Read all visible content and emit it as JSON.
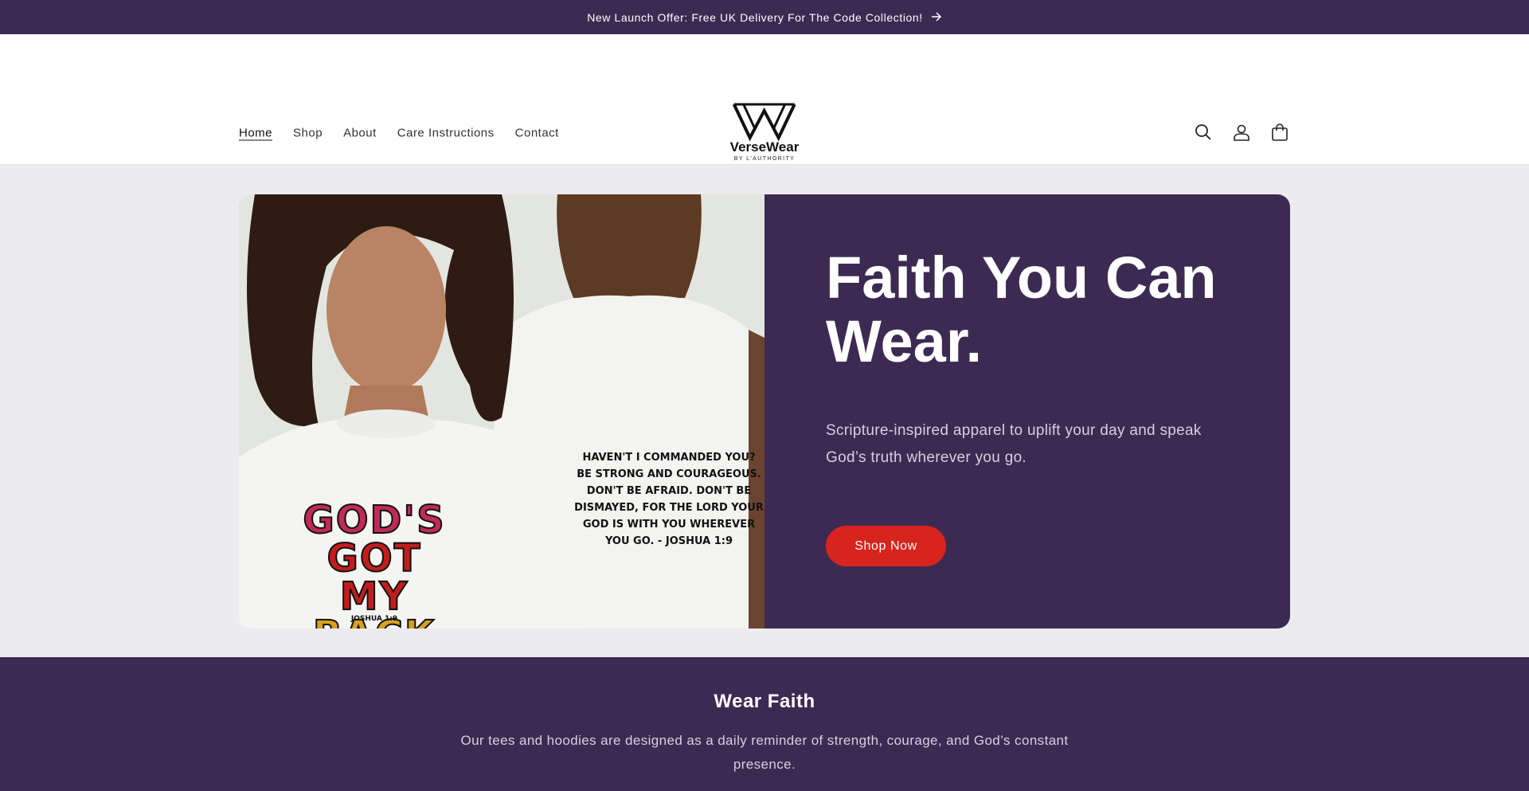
{
  "announcement": {
    "text": "New Launch Offer: Free UK Delivery For The Code Collection!",
    "arrow_icon": "arrow-right-icon"
  },
  "header": {
    "nav": [
      "Home",
      "Shop",
      "About",
      "Care Instructions",
      "Contact"
    ],
    "active_nav": "Home",
    "logo": {
      "word": "VerseWear",
      "sub": "BY L'AUTHORITY"
    },
    "icons": [
      "search-icon",
      "account-icon",
      "cart-icon"
    ]
  },
  "hero": {
    "title": "Faith You Can Wear.",
    "subtitle": "Scripture-inspired apparel to uplift your day and speak God’s truth wherever you go.",
    "button": "Shop Now",
    "image": {
      "back_verse": "HAVEN'T I COMMANDED YOU? BE STRONG AND COURAGEOUS. DON'T BE AFRAID. DON'T BE DISMAYED, FOR THE LORD YOUR GOD IS WITH YOU WHEREVER YOU GO. - JOSHUA 1:9",
      "front_line1": "GOD'S",
      "front_line2": "GOT MY",
      "front_line3": "BACK",
      "front_ref": "JOSHUA 1:9"
    }
  },
  "faith_section": {
    "title": "Wear Faith",
    "text": "Our tees and hoodies are designed as a daily reminder of strength, courage, and God’s constant presence."
  },
  "colors": {
    "brand_purple": "#3d2a52",
    "accent_red": "#d8241e",
    "page_bg": "#ecebf0"
  }
}
